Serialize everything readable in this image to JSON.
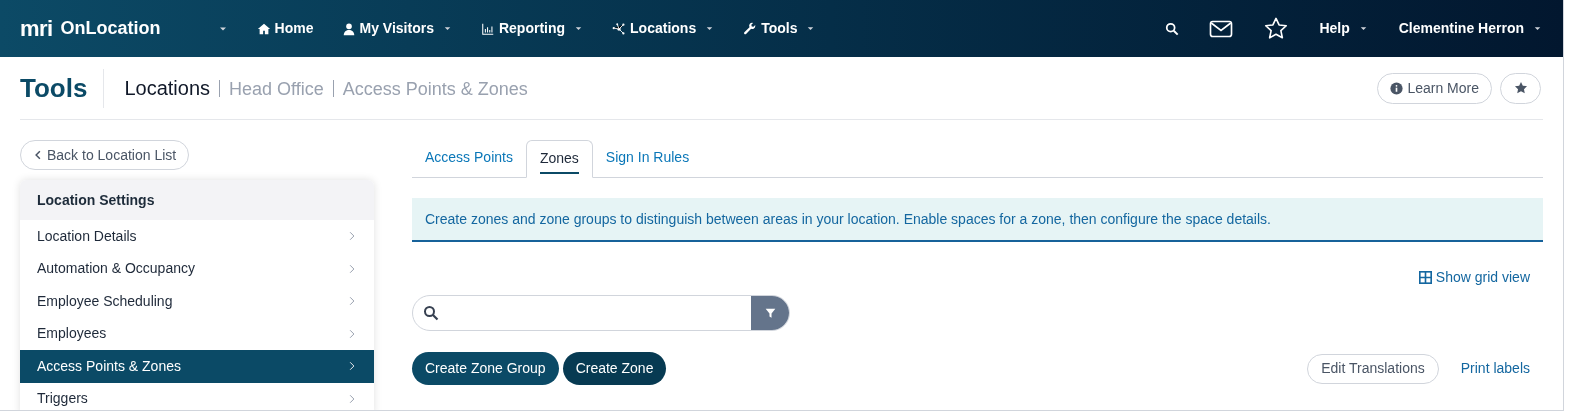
{
  "navbar": {
    "logo": "mri",
    "brand": "OnLocation",
    "items": [
      {
        "kind": "home",
        "label": "Home",
        "dropdown": false
      },
      {
        "kind": "user",
        "label": "My Visitors",
        "dropdown": true
      },
      {
        "kind": "chart",
        "label": "Reporting",
        "dropdown": true
      },
      {
        "kind": "network",
        "label": "Locations",
        "dropdown": true
      },
      {
        "kind": "wrench",
        "label": "Tools",
        "dropdown": true
      }
    ],
    "help": "Help",
    "user": "Clementine Herron"
  },
  "header": {
    "title": "Tools",
    "breadcrumb": [
      "Locations",
      "Head Office",
      "Access Points & Zones"
    ],
    "learn_more": "Learn More"
  },
  "back_button": "Back to Location List",
  "settings": {
    "heading": "Location Settings",
    "items": [
      {
        "label": "Location Details",
        "selected": false
      },
      {
        "label": "Automation & Occupancy",
        "selected": false
      },
      {
        "label": "Employee Scheduling",
        "selected": false
      },
      {
        "label": "Employees",
        "selected": false
      },
      {
        "label": "Access Points & Zones",
        "selected": true
      },
      {
        "label": "Triggers",
        "selected": false
      }
    ]
  },
  "tabs": [
    {
      "label": "Access Points",
      "selected": false
    },
    {
      "label": "Zones",
      "selected": true
    },
    {
      "label": "Sign In Rules",
      "selected": false
    }
  ],
  "info": "Create zones and zone groups to distinguish between areas in your location. Enable spaces for a zone, then configure the space details.",
  "grid_link": "Show grid view",
  "buttons": {
    "create_group": "Create Zone Group",
    "create_zone": "Create Zone",
    "edit_translations": "Edit Translations",
    "print_labels": "Print labels"
  }
}
